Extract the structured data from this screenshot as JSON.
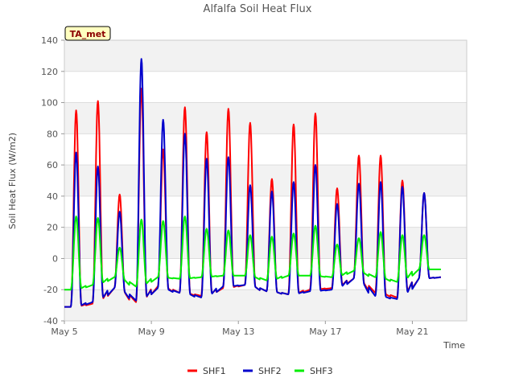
{
  "chart_data": {
    "type": "line",
    "title": "Alfalfa Soil Heat Flux",
    "xlabel": "Time",
    "ylabel": "Soil Heat Flux (W/m2)",
    "badge": "TA_met",
    "xlim": [
      "2024-05-05",
      "2024-05-23T12:00"
    ],
    "ylim": [
      -40,
      140
    ],
    "yticks": [
      -40,
      -20,
      0,
      20,
      40,
      60,
      80,
      100,
      120,
      140
    ],
    "xticks": [
      {
        "date": "2024-05-05",
        "label": "May 5"
      },
      {
        "date": "2024-05-09",
        "label": "May 9"
      },
      {
        "date": "2024-05-13",
        "label": "May 13"
      },
      {
        "date": "2024-05-17",
        "label": "May 17"
      },
      {
        "date": "2024-05-21",
        "label": "May 21"
      }
    ],
    "bands": "alternating light-gray horizontal bands",
    "legend_position": "bottom-center",
    "series": [
      {
        "name": "SHF1",
        "color": "#ff0000",
        "daily": [
          {
            "date": "2024-05-05",
            "min": -31,
            "max": 95
          },
          {
            "date": "2024-05-06",
            "min": -29,
            "max": 101
          },
          {
            "date": "2024-05-07",
            "min": -19,
            "max": 41
          },
          {
            "date": "2024-05-08",
            "min": -28,
            "max": 109
          },
          {
            "date": "2024-05-09",
            "min": -18,
            "max": 70
          },
          {
            "date": "2024-05-10",
            "min": -22,
            "max": 97
          },
          {
            "date": "2024-05-11",
            "min": -24,
            "max": 81
          },
          {
            "date": "2024-05-12",
            "min": -19,
            "max": 96
          },
          {
            "date": "2024-05-13",
            "min": -17,
            "max": 87
          },
          {
            "date": "2024-05-14",
            "min": -21,
            "max": 51
          },
          {
            "date": "2024-05-15",
            "min": -23,
            "max": 86
          },
          {
            "date": "2024-05-16",
            "min": -20,
            "max": 93
          },
          {
            "date": "2024-05-17",
            "min": -19,
            "max": 45
          },
          {
            "date": "2024-05-18",
            "min": -13,
            "max": 66
          },
          {
            "date": "2024-05-19",
            "min": -22,
            "max": 66
          },
          {
            "date": "2024-05-20",
            "min": -25,
            "max": 50
          },
          {
            "date": "2024-05-21",
            "min": -13,
            "max": 42
          },
          {
            "date": "2024-05-22",
            "min": -12,
            "max": -12
          }
        ]
      },
      {
        "name": "SHF2",
        "color": "#0000cc",
        "daily": [
          {
            "date": "2024-05-05",
            "min": -31,
            "max": 68
          },
          {
            "date": "2024-05-06",
            "min": -28,
            "max": 59
          },
          {
            "date": "2024-05-07",
            "min": -19,
            "max": 30
          },
          {
            "date": "2024-05-08",
            "min": -27,
            "max": 128
          },
          {
            "date": "2024-05-09",
            "min": -19,
            "max": 89
          },
          {
            "date": "2024-05-10",
            "min": -22,
            "max": 80
          },
          {
            "date": "2024-05-11",
            "min": -25,
            "max": 64
          },
          {
            "date": "2024-05-12",
            "min": -18,
            "max": 65
          },
          {
            "date": "2024-05-13",
            "min": -17,
            "max": 47
          },
          {
            "date": "2024-05-14",
            "min": -21,
            "max": 43
          },
          {
            "date": "2024-05-15",
            "min": -23,
            "max": 49
          },
          {
            "date": "2024-05-16",
            "min": -21,
            "max": 60
          },
          {
            "date": "2024-05-17",
            "min": -20,
            "max": 35
          },
          {
            "date": "2024-05-18",
            "min": -13,
            "max": 48
          },
          {
            "date": "2024-05-19",
            "min": -24,
            "max": 49
          },
          {
            "date": "2024-05-20",
            "min": -26,
            "max": 46
          },
          {
            "date": "2024-05-21",
            "min": -13,
            "max": 42
          },
          {
            "date": "2024-05-22",
            "min": -12,
            "max": -12
          }
        ]
      },
      {
        "name": "SHF3",
        "color": "#00ee00",
        "daily": [
          {
            "date": "2024-05-05",
            "min": -20,
            "max": 27
          },
          {
            "date": "2024-05-06",
            "min": -17,
            "max": 26
          },
          {
            "date": "2024-05-07",
            "min": -12,
            "max": 7
          },
          {
            "date": "2024-05-08",
            "min": -18,
            "max": 25
          },
          {
            "date": "2024-05-09",
            "min": -12,
            "max": 24
          },
          {
            "date": "2024-05-10",
            "min": -13,
            "max": 27
          },
          {
            "date": "2024-05-11",
            "min": -12,
            "max": 19
          },
          {
            "date": "2024-05-12",
            "min": -11,
            "max": 18
          },
          {
            "date": "2024-05-13",
            "min": -11,
            "max": 15
          },
          {
            "date": "2024-05-14",
            "min": -14,
            "max": 14
          },
          {
            "date": "2024-05-15",
            "min": -11,
            "max": 16
          },
          {
            "date": "2024-05-16",
            "min": -11,
            "max": 21
          },
          {
            "date": "2024-05-17",
            "min": -12,
            "max": 9
          },
          {
            "date": "2024-05-18",
            "min": -8,
            "max": 13
          },
          {
            "date": "2024-05-19",
            "min": -12,
            "max": 17
          },
          {
            "date": "2024-05-20",
            "min": -15,
            "max": 15
          },
          {
            "date": "2024-05-21",
            "min": -7,
            "max": 15
          },
          {
            "date": "2024-05-22",
            "min": -7,
            "max": -7
          }
        ]
      }
    ]
  }
}
